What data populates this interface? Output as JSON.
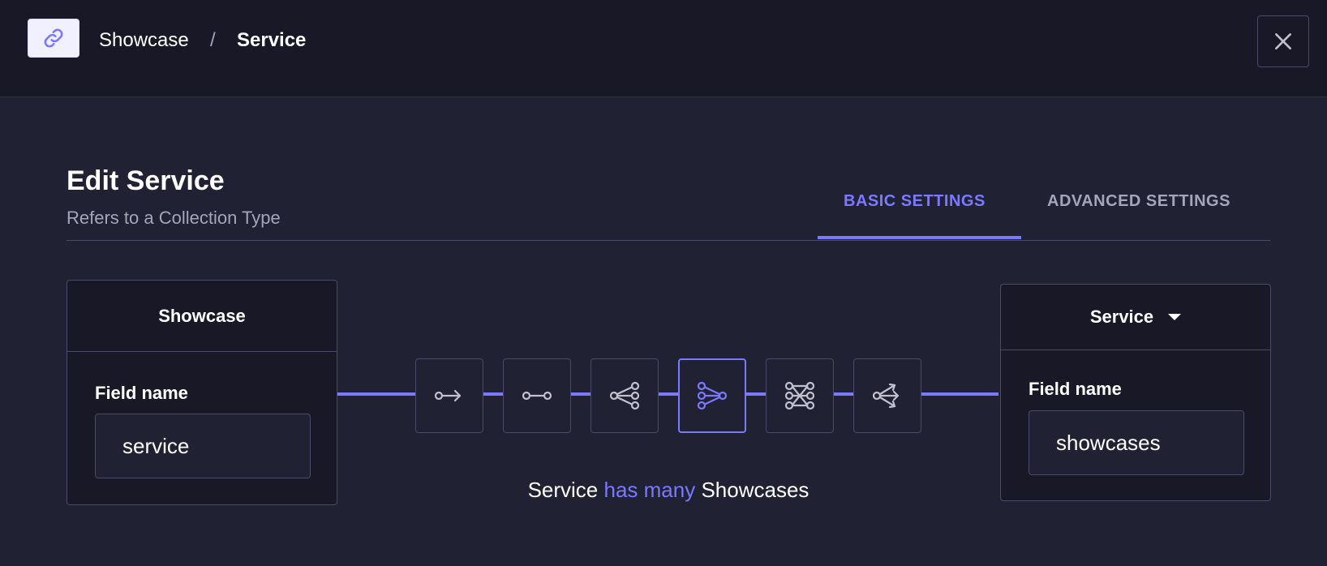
{
  "header": {
    "breadcrumb_first": "Showcase",
    "breadcrumb_separator": "/",
    "breadcrumb_current": "Service",
    "link_icon": "link-icon",
    "close_icon": "close-icon"
  },
  "modal": {
    "title": "Edit Service",
    "subtitle": "Refers to a Collection Type",
    "tabs": [
      {
        "label": "BASIC SETTINGS",
        "active": true
      },
      {
        "label": "ADVANCED SETTINGS",
        "active": false
      }
    ]
  },
  "left_card": {
    "header": "Showcase",
    "field_label": "Field name",
    "field_value": "service"
  },
  "right_card": {
    "header": "Service",
    "field_label": "Field name",
    "field_value": "showcases"
  },
  "relations": [
    {
      "icon": "one-way-icon",
      "active": false
    },
    {
      "icon": "one-to-one-icon",
      "active": false
    },
    {
      "icon": "one-to-many-icon",
      "active": false
    },
    {
      "icon": "many-to-one-icon",
      "active": true
    },
    {
      "icon": "many-to-many-icon",
      "active": false
    },
    {
      "icon": "many-way-icon",
      "active": false
    }
  ],
  "relation_text": {
    "subject": "Service",
    "verb": "has many",
    "object": "Showcases"
  },
  "colors": {
    "accent": "#7b79ff",
    "background": "#212134",
    "surface": "#181826",
    "border": "#4a4a6a"
  }
}
